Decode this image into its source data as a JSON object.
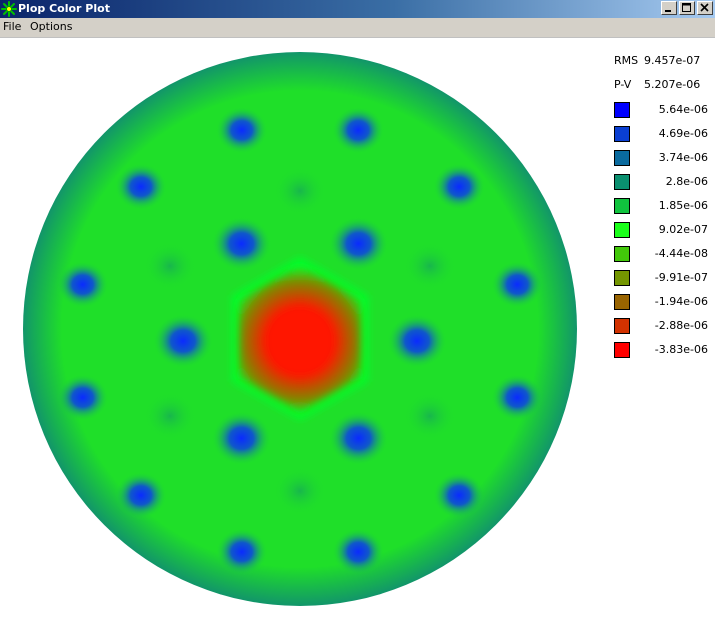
{
  "window": {
    "title": "Plop Color Plot"
  },
  "menu": [
    {
      "label": "File"
    },
    {
      "label": "Options"
    }
  ],
  "stats": [
    {
      "label": "RMS",
      "value": "9.457e-07"
    },
    {
      "label": "P-V",
      "value": "5.207e-06"
    }
  ],
  "legend": [
    {
      "value": "5.64e-06",
      "color": "#0000ff"
    },
    {
      "value": "4.69e-06",
      "color": "#0a3fd2"
    },
    {
      "value": "3.74e-06",
      "color": "#0a6a9e"
    },
    {
      "value": "2.8e-06",
      "color": "#0a8f6f"
    },
    {
      "value": "1.85e-06",
      "color": "#10c43e"
    },
    {
      "value": "9.02e-07",
      "color": "#1aff1a"
    },
    {
      "value": "-4.44e-08",
      "color": "#42c80a"
    },
    {
      "value": "-9.91e-07",
      "color": "#749600"
    },
    {
      "value": "-1.94e-06",
      "color": "#996400"
    },
    {
      "value": "-2.88e-06",
      "color": "#d23200"
    },
    {
      "value": "-3.83e-06",
      "color": "#ff0000"
    }
  ],
  "plot": {
    "base_color": "#1fdf29",
    "edge_color": "#12956a",
    "center_color": "#ff1500",
    "ring_color": "#00ff2a",
    "spot_color": "#0a2bff"
  },
  "icons": {
    "app": "star-burst-icon",
    "minimize": "minimize-icon",
    "maximize": "maximize-icon",
    "close": "close-icon"
  }
}
